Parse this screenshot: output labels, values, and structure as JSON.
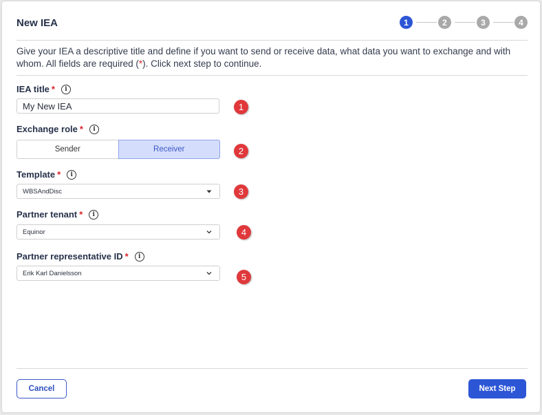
{
  "dialog": {
    "title": "New IEA",
    "description_before": "Give your IEA a descriptive title and define if you want to send or receive data, what data you want to exchange and with whom. All fields are required (",
    "description_required": "*",
    "description_after": "). Click next step to continue."
  },
  "stepper": {
    "steps": [
      "1",
      "2",
      "3",
      "4"
    ],
    "active": "1"
  },
  "fields": {
    "title": {
      "label": "IEA title",
      "required": "*",
      "value": "My New IEA"
    },
    "exchange_role": {
      "label": "Exchange role",
      "required": "*",
      "options": [
        "Sender",
        "Receiver"
      ],
      "selected": "Receiver"
    },
    "template": {
      "label": "Template",
      "required": "*",
      "value": "WBSAndDisc"
    },
    "partner_tenant": {
      "label": "Partner tenant",
      "required": "*",
      "value": "Equinor"
    },
    "partner_rep": {
      "label": "Partner representative ID",
      "required": "*",
      "value": "Erik Karl Danielsson"
    }
  },
  "annotations": [
    "1",
    "2",
    "3",
    "4",
    "5"
  ],
  "footer": {
    "cancel_label": "Cancel",
    "next_label": "Next Step"
  },
  "icons": {
    "info": "info-icon",
    "caret": "caret-down-icon",
    "chevron": "chevron-down-icon"
  },
  "colors": {
    "primary": "#2d56d6",
    "required": "#d8232a",
    "annotation": "#e0383b",
    "selected_bg": "#d4ddfb"
  }
}
